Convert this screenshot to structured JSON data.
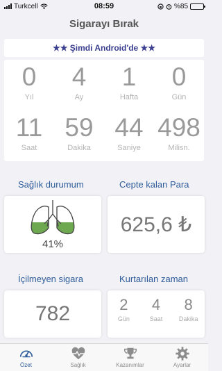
{
  "status_bar": {
    "carrier": "Turkcell",
    "time": "08:59",
    "battery": "%85",
    "battery_level": 0.85
  },
  "header": {
    "title": "Sigarayı Bırak"
  },
  "banner": {
    "text": "★★ Şimdi Android'de ★★"
  },
  "counters": [
    {
      "value": "0",
      "unit": "Yıl"
    },
    {
      "value": "4",
      "unit": "Ay"
    },
    {
      "value": "1",
      "unit": "Hafta"
    },
    {
      "value": "0",
      "unit": "Gün"
    },
    {
      "value": "11",
      "unit": "Saat"
    },
    {
      "value": "59",
      "unit": "Dakika"
    },
    {
      "value": "44",
      "unit": "Saniye"
    },
    {
      "value": "498",
      "unit": "Milisn."
    }
  ],
  "health": {
    "label": "Sağlık durumum",
    "percent": "41%",
    "level": 0.41
  },
  "money": {
    "label": "Cepte kalan Para",
    "value": "625,6 ₺"
  },
  "not_smoked": {
    "label": "İçilmeyen sigara",
    "value": "782"
  },
  "saved_time": {
    "label": "Kurtarılan zaman",
    "items": [
      {
        "value": "2",
        "unit": "Gün"
      },
      {
        "value": "4",
        "unit": "Saat"
      },
      {
        "value": "8",
        "unit": "Dakika"
      }
    ]
  },
  "tabs": [
    {
      "label": "Özet",
      "icon": "gauge-icon"
    },
    {
      "label": "Sağlık",
      "icon": "heartbeat-icon"
    },
    {
      "label": "Kazanımlar",
      "icon": "trophy-icon"
    },
    {
      "label": "Ayarlar",
      "icon": "gear-icon"
    }
  ],
  "colors": {
    "accent": "#2e5c9a",
    "lung_green": "#6ea850"
  }
}
